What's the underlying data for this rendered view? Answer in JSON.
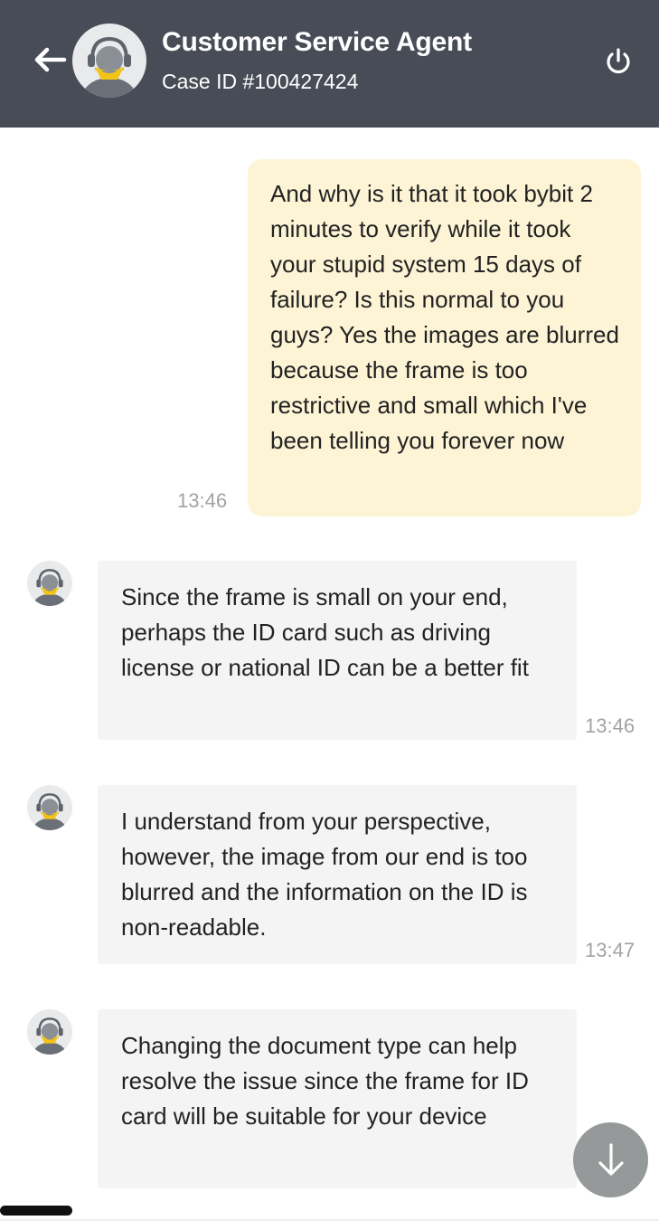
{
  "header": {
    "title": "Customer Service Agent",
    "case_id": "Case ID #100427424",
    "background": "#474c57",
    "icons": {
      "back": "back-arrow-icon",
      "power": "power-icon",
      "avatar": "agent-headset-avatar"
    }
  },
  "messages": [
    {
      "sender": "user",
      "text": "And why is it that it took bybit 2 minutes to verify while it took your stupid system 15 days of failure? Is this normal to you guys? Yes the images are blurred because the frame is too restrictive and small which I've been telling you forever now",
      "time": "13:46",
      "bubble_color": "#fdf4d6"
    },
    {
      "sender": "agent",
      "text": "Since the frame is small on your end, perhaps the ID card such as driving license or national ID can be a better fit",
      "time": "13:46",
      "bubble_color": "#f4f4f4"
    },
    {
      "sender": "agent",
      "text": "I understand from your perspective, however, the image from our end is too blurred and the information on the ID is non-readable.",
      "time": "13:47",
      "bubble_color": "#f4f4f4"
    },
    {
      "sender": "agent",
      "text": "Changing the document type can help resolve the issue since the frame for ID card will be suitable for your device",
      "time": "",
      "bubble_color": "#f4f4f4"
    }
  ],
  "scroll_button": {
    "icon": "arrow-down-icon",
    "color": "#969999"
  },
  "colors": {
    "accent": "#f3c316",
    "timestamp": "#a3a3a3"
  }
}
